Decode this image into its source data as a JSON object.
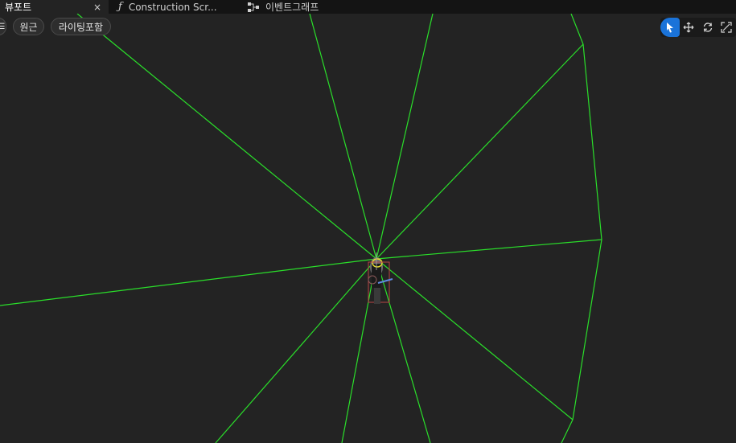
{
  "tabs": [
    {
      "label": "뷰포트",
      "close": "×"
    },
    {
      "label": "Construction Scr..."
    },
    {
      "label": "이벤트그래프"
    }
  ],
  "viewport_toolbar": {
    "menu_glyph": "☰",
    "perspective_label": "원근",
    "lighting_label": "라이팅포함"
  },
  "transform_tools": [
    {
      "icon": "select-arrow-icon",
      "active": true
    },
    {
      "icon": "move-icon"
    },
    {
      "icon": "rotate-icon"
    },
    {
      "icon": "scale-icon"
    }
  ],
  "colors": {
    "background": "#232323",
    "tabbar": "#141414",
    "accent": "#1a73d9",
    "gizmo_lines": "#2adf2a"
  }
}
